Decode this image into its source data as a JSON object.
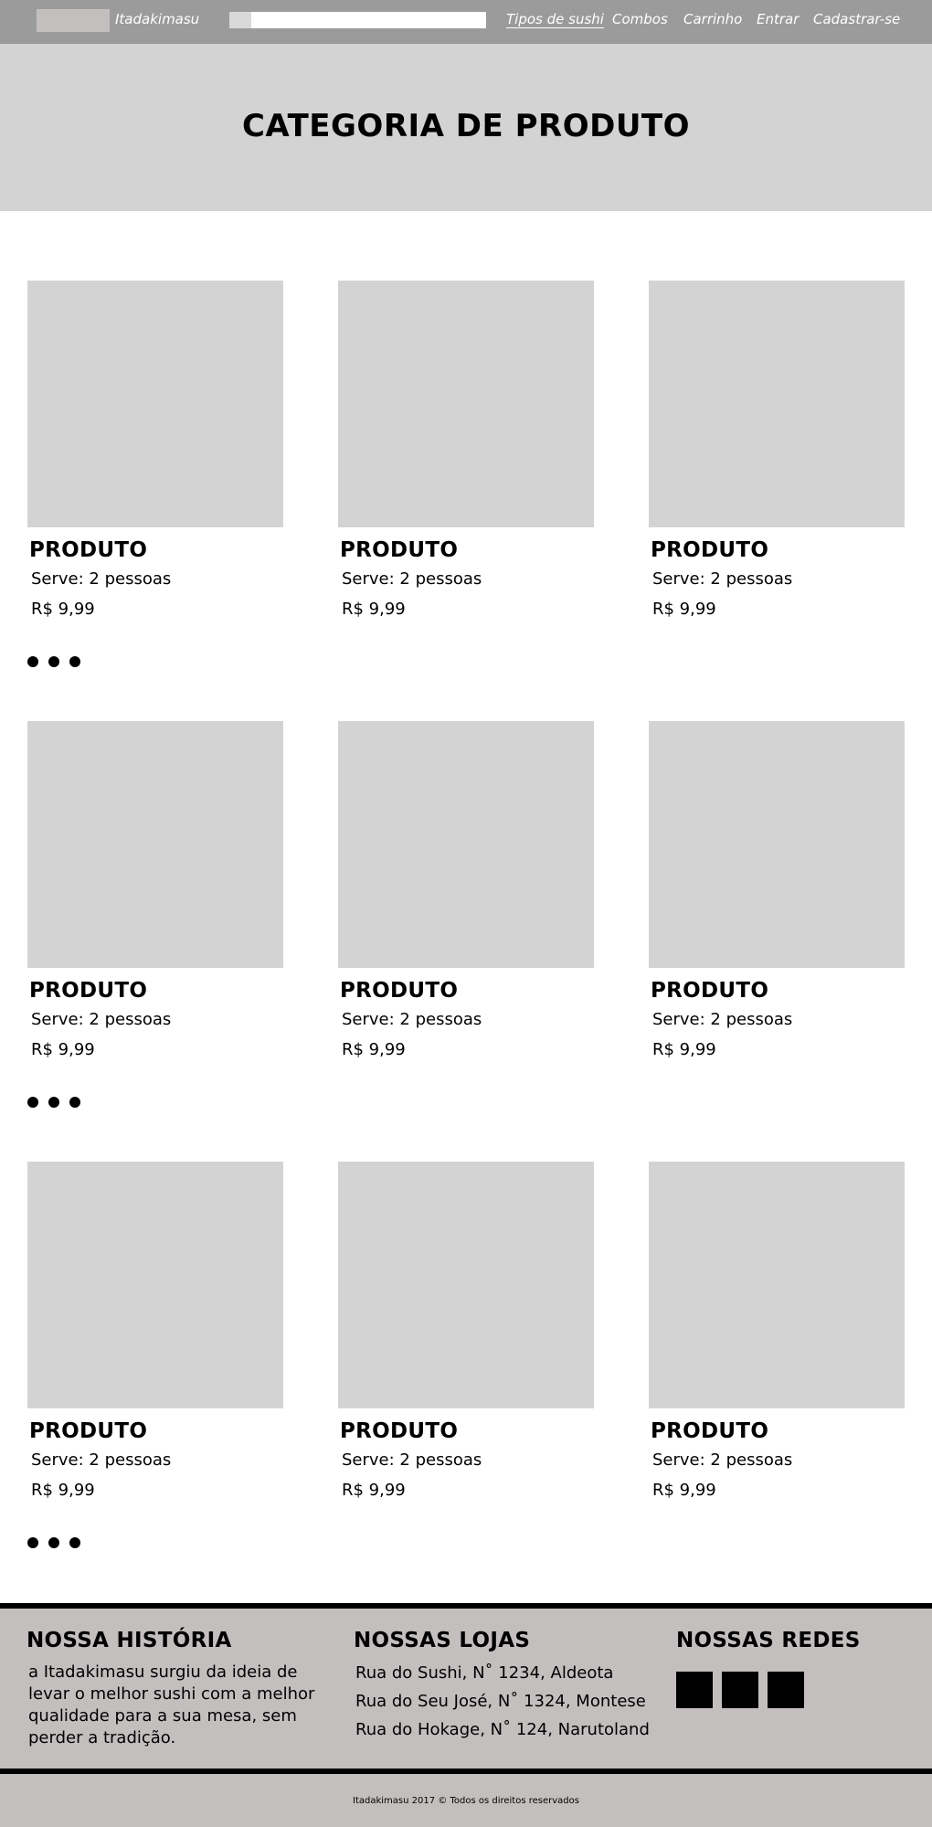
{
  "nav": {
    "brand": "Itadakimasu",
    "search_placeholder": "",
    "links": [
      "Tipos de sushi",
      "Combos",
      "Carrinho",
      "Entrar",
      "Cadastrar-se"
    ]
  },
  "hero": {
    "title": "CATEGORIA DE PRODUTO"
  },
  "products": [
    {
      "name": "PRODUTO",
      "serves": "Serve: 2 pessoas",
      "price": "R$ 9,99"
    },
    {
      "name": "PRODUTO",
      "serves": "Serve: 2 pessoas",
      "price": "R$ 9,99"
    },
    {
      "name": "PRODUTO",
      "serves": "Serve: 2 pessoas",
      "price": "R$ 9,99"
    },
    {
      "name": "PRODUTO",
      "serves": "Serve: 2 pessoas",
      "price": "R$ 9,99"
    },
    {
      "name": "PRODUTO",
      "serves": "Serve: 2 pessoas",
      "price": "R$ 9,99"
    },
    {
      "name": "PRODUTO",
      "serves": "Serve: 2 pessoas",
      "price": "R$ 9,99"
    },
    {
      "name": "PRODUTO",
      "serves": "Serve: 2 pessoas",
      "price": "R$ 9,99"
    },
    {
      "name": "PRODUTO",
      "serves": "Serve: 2 pessoas",
      "price": "R$ 9,99"
    },
    {
      "name": "PRODUTO",
      "serves": "Serve: 2 pessoas",
      "price": "R$ 9,99"
    }
  ],
  "footer": {
    "history_title": "NOSSA HISTÓRIA",
    "history_text": "a Itadakimasu surgiu da ideia de levar o melhor sushi com a melhor qualidade para a sua mesa, sem perder a tradição.",
    "stores_title": "NOSSAS LOJAS",
    "stores": [
      "Rua do Sushi, N˚ 1234, Aldeota",
      "Rua do Seu José, N˚ 1324, Montese",
      "Rua do Hokage, N˚ 124, Narutoland"
    ],
    "social_title": "NOSSAS REDES",
    "copyright": "Itadakimasu 2017  © Todos os direitos reservados"
  },
  "colors": {
    "topbar": "#9b9b9b",
    "hero": "#d3d3d3",
    "placeholder_image": "#d3d3d3",
    "footer": "#c4bfbf"
  }
}
